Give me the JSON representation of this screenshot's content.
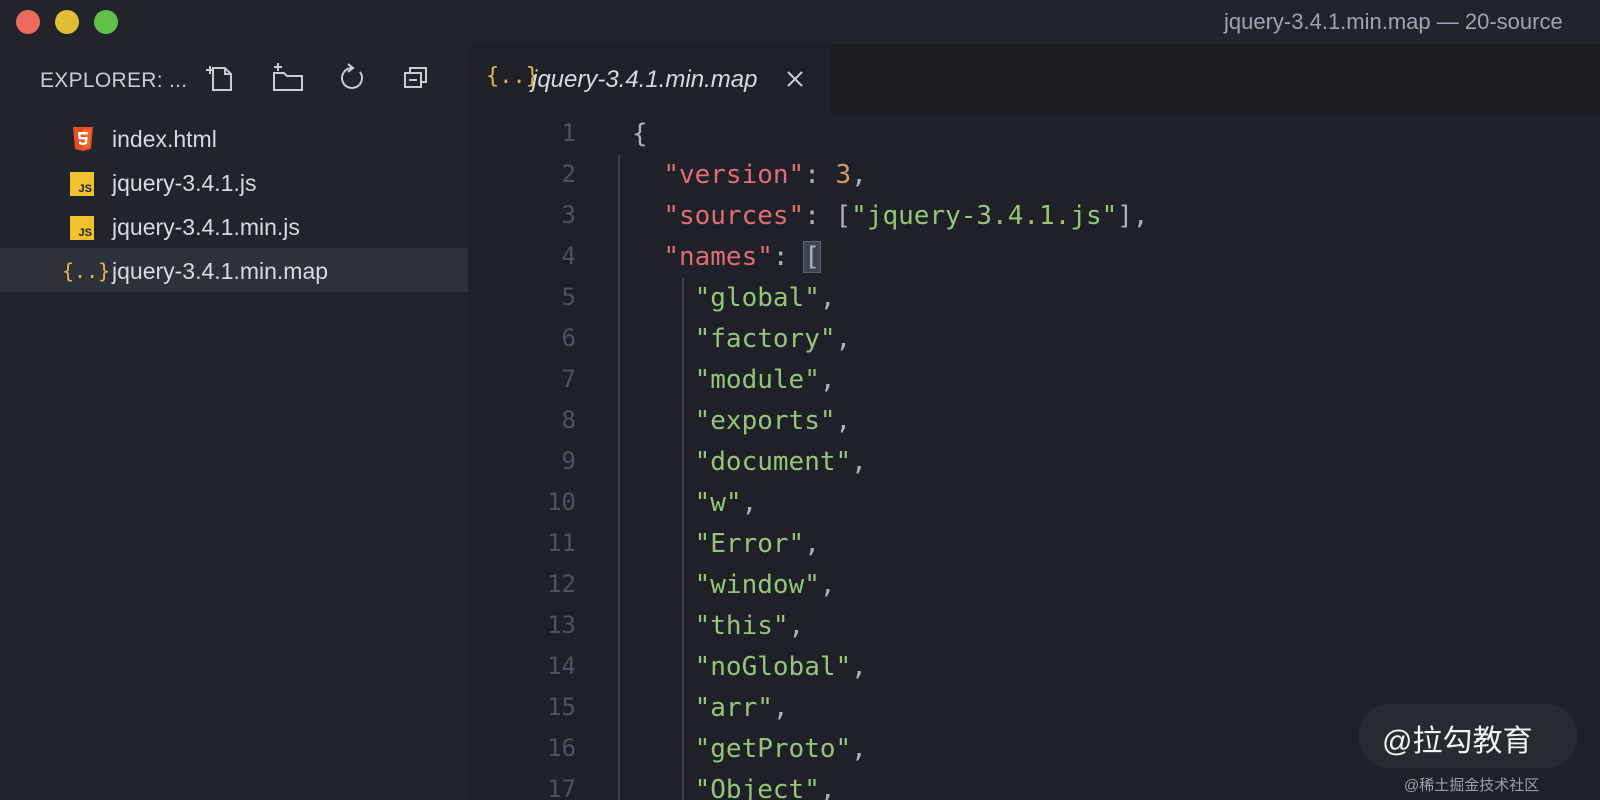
{
  "window": {
    "title": "jquery-3.4.1.min.map — 20-source"
  },
  "sidebar": {
    "title": "EXPLORER: ...",
    "actions": [
      "new-file",
      "new-folder",
      "refresh",
      "collapse-all"
    ],
    "items": [
      {
        "label": "index.html",
        "icon": "html5-icon"
      },
      {
        "label": "jquery-3.4.1.js",
        "icon": "js-icon"
      },
      {
        "label": "jquery-3.4.1.min.js",
        "icon": "js-icon"
      },
      {
        "label": "jquery-3.4.1.min.map",
        "icon": "json-icon",
        "selected": true
      }
    ]
  },
  "editor": {
    "tab": {
      "label": "jquery-3.4.1.min.map",
      "icon_text": "{..}"
    },
    "lines": [
      {
        "n": "1",
        "tokens": [
          {
            "t": "p",
            "v": "{"
          }
        ]
      },
      {
        "n": "2",
        "tokens": [
          {
            "t": "p",
            "v": "  "
          },
          {
            "t": "key",
            "v": "\"version\""
          },
          {
            "t": "p",
            "v": ": "
          },
          {
            "t": "num",
            "v": "3"
          },
          {
            "t": "p",
            "v": ","
          }
        ]
      },
      {
        "n": "3",
        "tokens": [
          {
            "t": "p",
            "v": "  "
          },
          {
            "t": "key",
            "v": "\"sources\""
          },
          {
            "t": "p",
            "v": ": ["
          },
          {
            "t": "str",
            "v": "\"jquery-3.4.1.js\""
          },
          {
            "t": "p",
            "v": "],"
          }
        ]
      },
      {
        "n": "4",
        "tokens": [
          {
            "t": "p",
            "v": "  "
          },
          {
            "t": "key",
            "v": "\"names\""
          },
          {
            "t": "p",
            "v": ": "
          },
          {
            "t": "hl",
            "v": "["
          }
        ]
      },
      {
        "n": "5",
        "tokens": [
          {
            "t": "p",
            "v": "    "
          },
          {
            "t": "str",
            "v": "\"global\""
          },
          {
            "t": "p",
            "v": ","
          }
        ]
      },
      {
        "n": "6",
        "tokens": [
          {
            "t": "p",
            "v": "    "
          },
          {
            "t": "str",
            "v": "\"factory\""
          },
          {
            "t": "p",
            "v": ","
          }
        ]
      },
      {
        "n": "7",
        "tokens": [
          {
            "t": "p",
            "v": "    "
          },
          {
            "t": "str",
            "v": "\"module\""
          },
          {
            "t": "p",
            "v": ","
          }
        ]
      },
      {
        "n": "8",
        "tokens": [
          {
            "t": "p",
            "v": "    "
          },
          {
            "t": "str",
            "v": "\"exports\""
          },
          {
            "t": "p",
            "v": ","
          }
        ]
      },
      {
        "n": "9",
        "tokens": [
          {
            "t": "p",
            "v": "    "
          },
          {
            "t": "str",
            "v": "\"document\""
          },
          {
            "t": "p",
            "v": ","
          }
        ]
      },
      {
        "n": "10",
        "tokens": [
          {
            "t": "p",
            "v": "    "
          },
          {
            "t": "str",
            "v": "\"w\""
          },
          {
            "t": "p",
            "v": ","
          }
        ]
      },
      {
        "n": "11",
        "tokens": [
          {
            "t": "p",
            "v": "    "
          },
          {
            "t": "str",
            "v": "\"Error\""
          },
          {
            "t": "p",
            "v": ","
          }
        ]
      },
      {
        "n": "12",
        "tokens": [
          {
            "t": "p",
            "v": "    "
          },
          {
            "t": "str",
            "v": "\"window\""
          },
          {
            "t": "p",
            "v": ","
          }
        ]
      },
      {
        "n": "13",
        "tokens": [
          {
            "t": "p",
            "v": "    "
          },
          {
            "t": "str",
            "v": "\"this\""
          },
          {
            "t": "p",
            "v": ","
          }
        ]
      },
      {
        "n": "14",
        "tokens": [
          {
            "t": "p",
            "v": "    "
          },
          {
            "t": "str",
            "v": "\"noGlobal\""
          },
          {
            "t": "p",
            "v": ","
          }
        ]
      },
      {
        "n": "15",
        "tokens": [
          {
            "t": "p",
            "v": "    "
          },
          {
            "t": "str",
            "v": "\"arr\""
          },
          {
            "t": "p",
            "v": ","
          }
        ]
      },
      {
        "n": "16",
        "tokens": [
          {
            "t": "p",
            "v": "    "
          },
          {
            "t": "str",
            "v": "\"getProto\""
          },
          {
            "t": "p",
            "v": ","
          }
        ]
      },
      {
        "n": "17",
        "tokens": [
          {
            "t": "p",
            "v": "    "
          },
          {
            "t": "str",
            "v": "\"Object\""
          },
          {
            "t": "p",
            "v": ","
          }
        ]
      }
    ]
  },
  "colors": {
    "key": "#e06c75",
    "string": "#98c379",
    "number": "#d19a66",
    "punctuation": "#abb2bf",
    "line_number": "#4b5263",
    "html_icon": "#e44d26",
    "js_icon": "#f0c12c",
    "json_icon": "#e5b54a"
  },
  "watermark": {
    "main": "@拉勾教育",
    "sub": "@稀土掘金技术社区"
  }
}
